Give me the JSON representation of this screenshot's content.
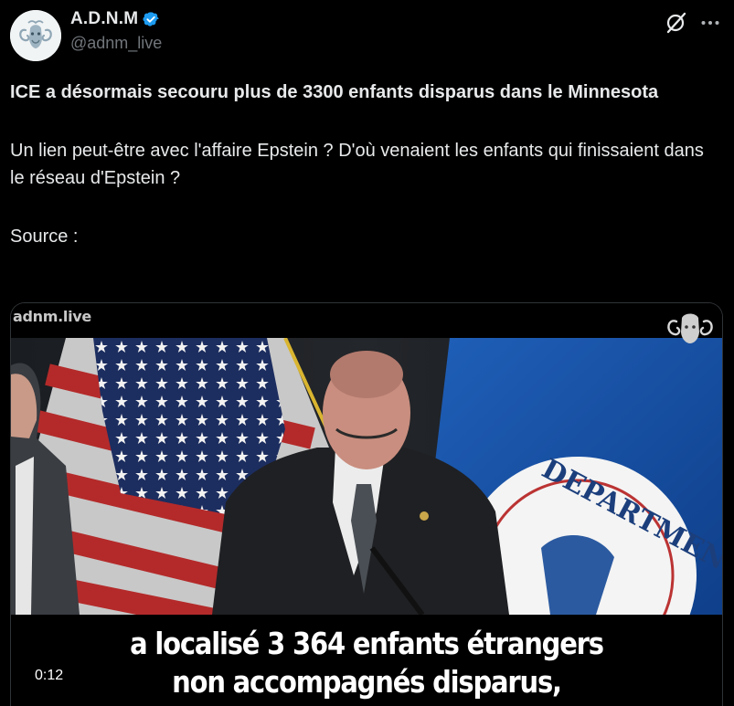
{
  "colors": {
    "background": "#000000",
    "text": "#e7e9ea",
    "muted": "#71767b",
    "verified": "#1d9bf0"
  },
  "author": {
    "display_name": "A.D.N.M",
    "handle": "@adnm_live",
    "avatar_icon": "ram-logo-avatar",
    "verified_icon": "verified-badge-icon"
  },
  "actions": {
    "grok_icon": "grok-slash-icon",
    "more_icon": "more-dots-icon"
  },
  "tweet": {
    "title": "ICE a désormais secouru plus de 3300 enfants disparus dans le Minnesota",
    "paragraph": "Un lien peut-être avec l'affaire Epstein ? D'où venaient les enfants qui finissaient dans le réseau d'Epstein ?",
    "source_label": "Source :"
  },
  "video": {
    "watermark": "adnm.live",
    "subtitle_line1": "a localisé 3 364 enfants étrangers",
    "subtitle_line2": "non accompagnés disparus,",
    "timestamp": "0:12",
    "seal_text": "DEPARTMENT"
  }
}
